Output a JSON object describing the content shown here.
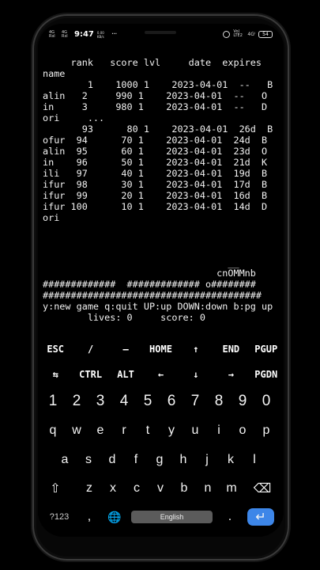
{
  "status_bar": {
    "sim1": "4G\nRııl",
    "sim2": "4G\nRııl",
    "time": "9:47",
    "net_speed": "0.00\nKB/s",
    "dots": "···",
    "volte": "Vo)\nLTE2",
    "signal": "4Gᴵ",
    "battery": "54"
  },
  "terminal": {
    "lines": [
      "     rank   score lvl     date  expires",
      "name",
      "        1    1000 1    2023-04-01  --   B",
      "alin   2     990 1    2023-04-01  --   O",
      "in     3     980 1    2023-04-01  --   D",
      "ori     ...",
      "       93      80 1    2023-04-01  26d  B",
      "ofur  94      70 1    2023-04-01  24d  B",
      "alin  95      60 1    2023-04-01  23d  O",
      "in    96      50 1    2023-04-01  21d  K",
      "ili   97      40 1    2023-04-01  19d  B",
      "ifur  98      30 1    2023-04-01  17d  B",
      "ifur  99      20 1    2023-04-01  16d  B",
      "ifur 100      10 1    2023-04-01  14d  D",
      "ori",
      "",
      "",
      "",
      "",
      "                               cnO̅M̅Mnb",
      "#############  ############# o########",
      "#######################################",
      "y:new game q:quit UP:up DOWN:down b:pg up",
      "        lives: 0     score: 0"
    ]
  },
  "extra_keys": {
    "row1": [
      "ESC",
      "/",
      "—",
      "HOME",
      "↑",
      "END",
      "PGUP"
    ],
    "row2": [
      "⇆",
      "CTRL",
      "ALT",
      "←",
      "↓",
      "→",
      "PGDN"
    ]
  },
  "keyboard": {
    "numbers": [
      "1",
      "2",
      "3",
      "4",
      "5",
      "6",
      "7",
      "8",
      "9",
      "0"
    ],
    "row1": [
      "q",
      "w",
      "e",
      "r",
      "t",
      "y",
      "u",
      "i",
      "o",
      "p"
    ],
    "row2": [
      "a",
      "s",
      "d",
      "f",
      "g",
      "h",
      "j",
      "k",
      "l"
    ],
    "row3": [
      "z",
      "x",
      "c",
      "v",
      "b",
      "n",
      "m"
    ],
    "shift": "⇧",
    "backspace": "⌫",
    "symbols": "?123",
    "comma": ",",
    "globe": "🌐",
    "space": "English",
    "period": ".",
    "enter": "↵"
  },
  "colors": {
    "enter_key": "#3d86e8",
    "space_key": "#5b5b5b"
  }
}
